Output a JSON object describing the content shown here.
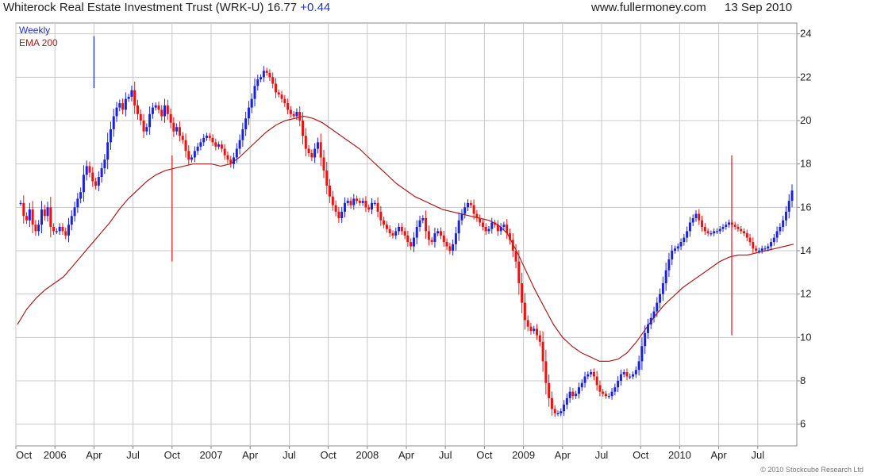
{
  "header": {
    "title": "Whiterock Real Estate Investment Trust (WRK-U) 16.77",
    "change": "+0.44",
    "site": "www.fullermoney.com",
    "date": "13 Sep 2010"
  },
  "legend": {
    "series1": "Weekly",
    "series2": "EMA 200"
  },
  "copyright": "© 2010 Stockcube Research Ltd",
  "colors": {
    "up": "#1a22dd",
    "down": "#ee1111",
    "ema": "#a52020",
    "grid": "#c8c8c8",
    "legend_weekly": "#2233bb",
    "legend_ema": "#a52020"
  },
  "chart_data": {
    "type": "line",
    "title": "Whiterock Real Estate Investment Trust (WRK-U) 16.77 +0.44",
    "x_tick_labels": [
      "Oct",
      "2006",
      "Apr",
      "Jul",
      "Oct",
      "2007",
      "Apr",
      "Jul",
      "Oct",
      "2008",
      "Apr",
      "Jul",
      "Oct",
      "2009",
      "Apr",
      "Jul",
      "Oct",
      "2010",
      "Apr",
      "Jul"
    ],
    "xlim": [
      "2005-10",
      "2010-09"
    ],
    "y_ticks": [
      6,
      8,
      10,
      12,
      14,
      16,
      18,
      20,
      22,
      24
    ],
    "ylim": [
      5.0,
      24.5
    ],
    "y_axis_side": "right",
    "grid": true,
    "legend_position": "top-left",
    "series": [
      {
        "name": "Weekly",
        "style": "weekly-candles",
        "values": [
          16.2,
          15.6,
          15.4,
          15.9,
          15.2,
          14.9,
          15.2,
          15.9,
          15.6,
          16.0,
          15.1,
          14.9,
          14.9,
          15.1,
          14.9,
          14.7,
          15.2,
          15.6,
          16.0,
          16.4,
          16.7,
          17.5,
          17.9,
          17.6,
          17.2,
          17.0,
          17.4,
          17.8,
          18.2,
          19.0,
          19.6,
          20.2,
          20.6,
          20.8,
          20.5,
          21.0,
          21.1,
          21.4,
          20.7,
          20.3,
          20.0,
          19.5,
          19.7,
          20.3,
          20.6,
          20.7,
          20.5,
          20.2,
          20.7,
          20.3,
          19.9,
          19.5,
          19.7,
          19.3,
          19.1,
          18.6,
          18.2,
          18.3,
          18.6,
          18.8,
          19.0,
          19.2,
          19.3,
          19.2,
          19.0,
          18.8,
          18.9,
          18.7,
          18.4,
          18.2,
          18.0,
          18.3,
          18.7,
          19.1,
          19.6,
          20.1,
          20.6,
          21.0,
          21.6,
          21.9,
          22.0,
          22.3,
          22.2,
          22.0,
          21.7,
          21.3,
          21.2,
          21.0,
          20.8,
          20.5,
          20.3,
          20.2,
          20.4,
          20.0,
          19.3,
          18.7,
          18.5,
          18.3,
          18.7,
          19.0,
          18.3,
          17.7,
          17.0,
          16.5,
          16.1,
          15.8,
          15.5,
          15.8,
          16.2,
          16.3,
          16.1,
          16.4,
          16.3,
          16.2,
          16.3,
          16.0,
          15.9,
          16.2,
          16.2,
          15.8,
          15.4,
          15.2,
          15.0,
          14.8,
          14.7,
          14.9,
          15.1,
          14.9,
          14.7,
          14.4,
          14.2,
          14.6,
          15.1,
          15.4,
          15.5,
          14.9,
          14.5,
          14.4,
          14.8,
          14.9,
          14.7,
          14.4,
          14.2,
          14.0,
          14.3,
          14.8,
          15.4,
          15.7,
          16.0,
          16.2,
          16.1,
          15.7,
          15.5,
          15.3,
          15.1,
          14.9,
          15.0,
          15.3,
          15.2,
          14.9,
          15.1,
          15.2,
          14.8,
          14.5,
          14.0,
          13.5,
          12.5,
          11.6,
          10.8,
          10.5,
          10.3,
          10.4,
          10.1,
          9.8,
          8.9,
          7.9,
          7.2,
          6.7,
          6.5,
          6.5,
          6.6,
          6.9,
          7.2,
          7.5,
          7.3,
          7.4,
          7.7,
          7.9,
          8.2,
          8.3,
          8.4,
          8.2,
          7.8,
          7.5,
          7.4,
          7.3,
          7.3,
          7.5,
          7.7,
          8.0,
          8.3,
          8.4,
          8.2,
          8.2,
          8.3,
          8.5,
          8.9,
          9.6,
          10.2,
          10.6,
          10.9,
          11.2,
          11.6,
          12.0,
          12.5,
          13.1,
          13.6,
          14.0,
          14.1,
          14.2,
          14.4,
          14.6,
          14.9,
          15.3,
          15.5,
          15.7,
          15.4,
          15.1,
          14.9,
          14.8,
          14.8,
          14.9,
          14.9,
          15.0,
          15.1,
          15.2,
          15.3,
          15.2,
          15.1,
          15.0,
          14.9,
          14.8,
          14.6,
          14.4,
          14.1,
          14.0,
          14.0,
          14.1,
          14.1,
          14.2,
          14.4,
          14.6,
          14.9,
          15.1,
          15.4,
          15.8,
          16.3,
          16.77
        ]
      },
      {
        "name": "EMA 200",
        "style": "line",
        "values": [
          10.6,
          11.3,
          11.8,
          12.2,
          12.5,
          12.8,
          13.3,
          13.8,
          14.3,
          14.8,
          15.3,
          15.9,
          16.4,
          16.8,
          17.2,
          17.5,
          17.7,
          17.8,
          17.9,
          18.0,
          18.0,
          18.0,
          17.9,
          18.0,
          18.3,
          18.7,
          19.1,
          19.5,
          19.8,
          20.0,
          20.1,
          20.2,
          20.1,
          19.9,
          19.6,
          19.3,
          19.0,
          18.7,
          18.3,
          17.9,
          17.5,
          17.1,
          16.8,
          16.5,
          16.3,
          16.1,
          15.9,
          15.8,
          15.7,
          15.6,
          15.5,
          15.4,
          15.2,
          14.8,
          14.0,
          13.1,
          12.2,
          11.4,
          10.6,
          10.0,
          9.6,
          9.3,
          9.1,
          8.9,
          8.9,
          9.0,
          9.3,
          9.8,
          10.4,
          11.0,
          11.5,
          11.9,
          12.3,
          12.6,
          12.9,
          13.2,
          13.5,
          13.7,
          13.8,
          13.8,
          13.9,
          14.0,
          14.1,
          14.2,
          14.3
        ]
      }
    ],
    "annotations": [
      {
        "type": "spike-low",
        "x": "2006-10",
        "low": 13.5
      },
      {
        "type": "spike-low",
        "x": "2010-05",
        "low": 10.1
      },
      {
        "type": "spike-high",
        "x": "2006-04",
        "high": 23.9
      }
    ]
  }
}
